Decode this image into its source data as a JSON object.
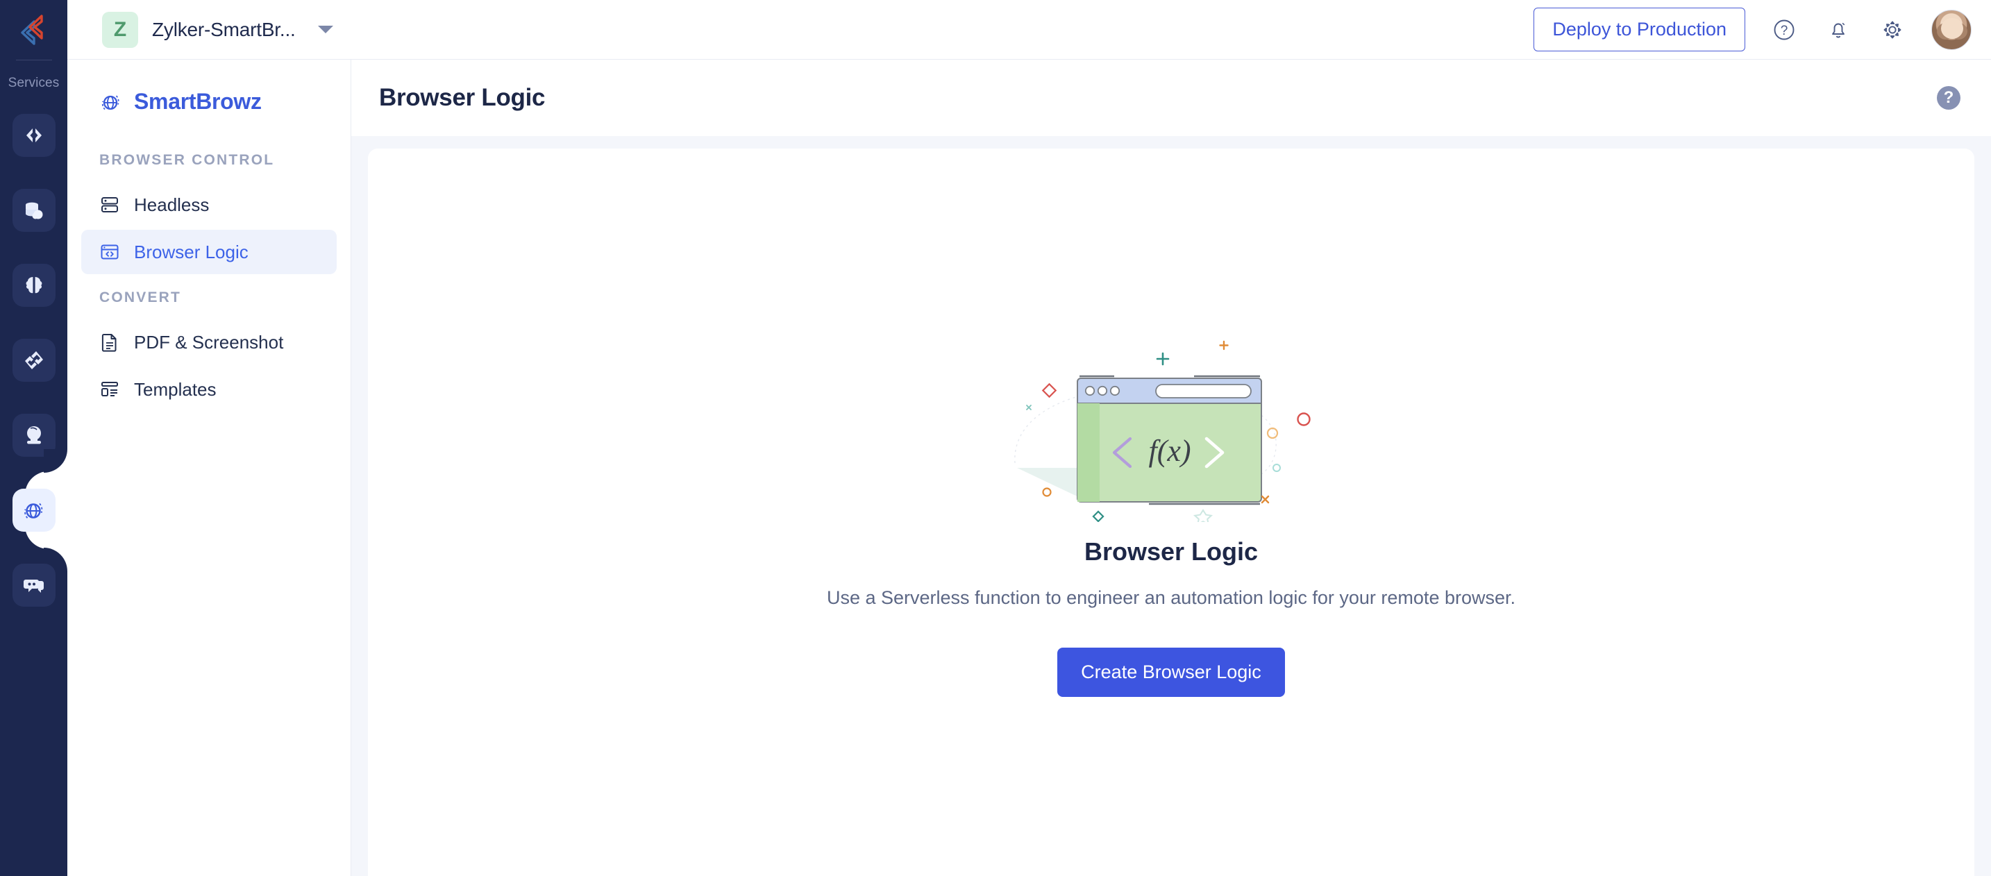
{
  "app": {
    "logo_icon": "zoho-catalyst-logo-icon"
  },
  "rail": {
    "section_label": "Services",
    "items": [
      {
        "name": "code-icon",
        "label": "Functions",
        "active": false
      },
      {
        "name": "database-cloud-icon",
        "label": "Data Store",
        "active": false
      },
      {
        "name": "brain-icon",
        "label": "AI",
        "active": false
      },
      {
        "name": "link-chain-icon",
        "label": "Circuits",
        "active": false
      },
      {
        "name": "crystal-ball-icon",
        "label": "Insights",
        "active": false
      },
      {
        "name": "globe-icon",
        "label": "SmartBrowz",
        "active": true
      },
      {
        "name": "chat-bubbles-icon",
        "label": "Chat",
        "active": false
      }
    ]
  },
  "topbar": {
    "org_initial": "Z",
    "org_name": "Zylker-SmartBr...",
    "org_caret_icon": "chevron-down-icon",
    "deploy_label": "Deploy to Production",
    "help_icon": "help-circle-icon",
    "bell_icon": "bell-icon",
    "settings_icon": "gear-icon",
    "avatar_icon": "user-avatar"
  },
  "sidebar": {
    "brand": "SmartBrowz",
    "brand_icon": "globe-icon",
    "groups": [
      {
        "label": "BROWSER CONTROL",
        "items": [
          {
            "label": "Headless",
            "icon": "server-stack-icon",
            "active": false
          },
          {
            "label": "Browser Logic",
            "icon": "browser-code-icon",
            "active": true
          }
        ]
      },
      {
        "label": "CONVERT",
        "items": [
          {
            "label": "PDF & Screenshot",
            "icon": "document-icon",
            "active": false
          },
          {
            "label": "Templates",
            "icon": "layout-template-icon",
            "active": false
          }
        ]
      }
    ]
  },
  "main": {
    "page_title": "Browser Logic",
    "help_badge": "?",
    "empty_state": {
      "illustration": "browser-window-function-illustration",
      "title": "Browser Logic",
      "subtitle": "Use a Serverless function to engineer an automation logic for your remote browser.",
      "cta_label": "Create Browser Logic"
    }
  },
  "colors": {
    "rail_bg": "#1c274f",
    "brand_blue": "#3b5bdb",
    "primary_button": "#3d55e0",
    "active_nav_bg": "#eef2fc",
    "page_bg": "#f4f6fb",
    "org_badge_bg": "#d9f2e3",
    "illustration_green": "#c6e3b8",
    "illustration_titlebar": "#c3d2f0"
  }
}
